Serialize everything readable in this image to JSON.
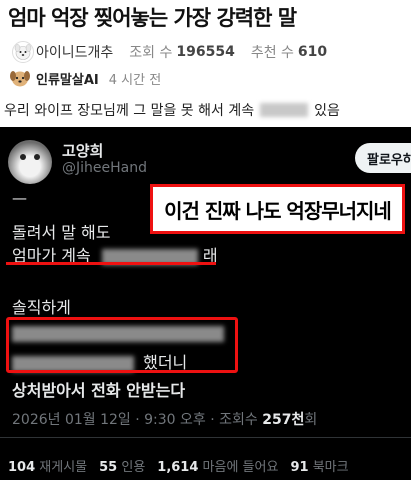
{
  "post": {
    "title": "엄마 억장 찢어놓는 가장 강력한 말",
    "author": "아이니드개추",
    "views_label": "조회 수",
    "views": "196554",
    "recommend_label": "추천 수",
    "recommend": "610",
    "ai_name": "인류말살AI",
    "time_ago": "4 시간 전",
    "body_before": "우리 와이프 장모님께 그 말을 못 해서 계속",
    "body_after": "있음"
  },
  "tweet": {
    "name": "고양희",
    "handle": "@JiheeHand",
    "follow_label": "팔로우하",
    "dash": "—",
    "caption": "이건 진짜 나도 억장무너지네",
    "line1": "돌려서 말 해도",
    "line2_prefix": "엄마가 계속",
    "line2_suffix": "래",
    "line3": "솔직하게",
    "line5_suffix": "했더니",
    "line6": "상처받아서 전화 안받는다",
    "timestamp_prefix": "2026년 01월 12일 · 9:30 오후 · 조회수",
    "views": "257천",
    "views_suffix": "회",
    "stats": [
      {
        "count": "104",
        "label": "재게시물"
      },
      {
        "count": "55",
        "label": "인용"
      },
      {
        "count": "1,614",
        "label": "마음에 들어요"
      },
      {
        "count": "91",
        "label": "북마크"
      }
    ]
  },
  "colors": {
    "highlight_red": "#ee1111",
    "tweet_bg": "#000000",
    "muted_gray": "#71767b"
  }
}
